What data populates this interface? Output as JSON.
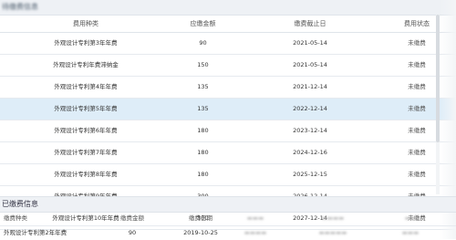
{
  "unpaid_section": {
    "title": "待缴费信息",
    "columns": [
      "费用种类",
      "应缴金额",
      "缴费截止日",
      "费用状态"
    ],
    "rows": [
      {
        "type": "外观设计专利第3年年费",
        "amount": "90",
        "deadline": "2021-05-14",
        "status": "未缴费"
      },
      {
        "type": "外观设计专利年费滞纳金",
        "amount": "150",
        "deadline": "2021-05-14",
        "status": "未缴费"
      },
      {
        "type": "外观设计专利第4年年费",
        "amount": "135",
        "deadline": "2021-12-14",
        "status": "未缴费"
      },
      {
        "type": "外观设计专利第5年年费",
        "amount": "135",
        "deadline": "2022-12-14",
        "status": "未缴费"
      },
      {
        "type": "外观设计专利第6年年费",
        "amount": "180",
        "deadline": "2023-12-14",
        "status": "未缴费"
      },
      {
        "type": "外观设计专利第7年年费",
        "amount": "180",
        "deadline": "2024-12-16",
        "status": "未缴费"
      },
      {
        "type": "外观设计专利第8年年费",
        "amount": "180",
        "deadline": "2025-12-15",
        "status": "未缴费"
      },
      {
        "type": "外观设计专利第9年年费",
        "amount": "300",
        "deadline": "2026-12-14",
        "status": "未缴费"
      },
      {
        "type": "外观设计专利第10年年费",
        "amount": "300",
        "deadline": "2027-12-14",
        "status": "未缴费"
      }
    ]
  },
  "paid_section": {
    "title": "已缴费信息",
    "columns": [
      "缴费种类",
      "缴费金额",
      "缴费日期"
    ],
    "rows": [
      {
        "type": "外观设计专利第2年年费",
        "amount": "90",
        "date": "2019-10-25"
      }
    ]
  }
}
